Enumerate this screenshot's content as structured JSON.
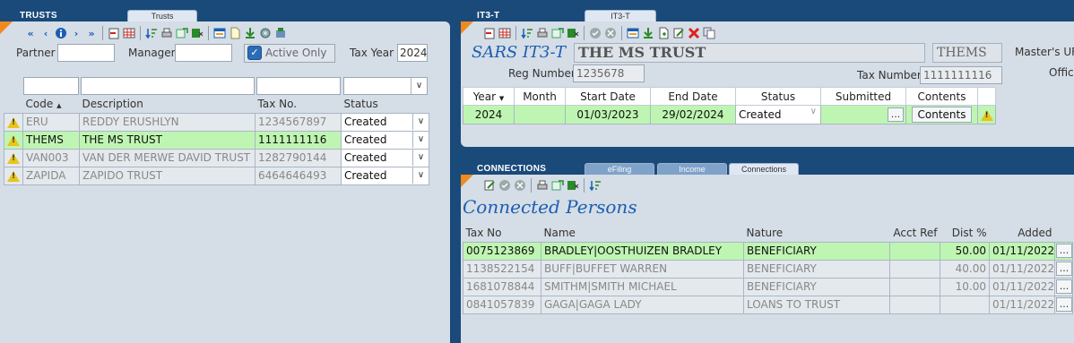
{
  "trusts": {
    "panel_title": "TRUSTS",
    "tab": "Trusts",
    "filters": {
      "partner_label": "Partner",
      "partner_value": "",
      "manager_label": "Manager",
      "manager_value": "",
      "active_only_label": "Active Only",
      "active_only_checked": true,
      "tax_year_label": "Tax Year",
      "tax_year_value": "2024"
    },
    "columns": [
      "Code",
      "Description",
      "Tax No.",
      "Status"
    ],
    "rows": [
      {
        "code": "ERU",
        "description": "REDDY ERUSHLYN",
        "tax_no": "1234567897",
        "status": "Created"
      },
      {
        "code": "THEMS",
        "description": "THE MS TRUST",
        "tax_no": "1111111116",
        "status": "Created"
      },
      {
        "code": "VAN003",
        "description": "VAN DER MERWE DAVID TRUST",
        "tax_no": "1282790144",
        "status": "Created"
      },
      {
        "code": "ZAPIDA",
        "description": "ZAPIDO TRUST",
        "tax_no": "6464646493",
        "status": "Created"
      }
    ],
    "selected_index": 1
  },
  "it3t": {
    "panel_title": "IT3-T",
    "tab": "IT3-T",
    "heading": "SARS IT3-T",
    "trust_name": "THE MS TRUST",
    "trust_code": "THEMS",
    "reg_label": "Reg Number",
    "reg_value": "1235678",
    "tax_label": "Tax Number",
    "tax_value": "1111111116",
    "master_label": "Master's URN",
    "office_label": "Office",
    "columns": [
      "Year",
      "Month",
      "Start Date",
      "End Date",
      "Status",
      "Submitted",
      "Contents"
    ],
    "row": {
      "year": "2024",
      "month": "",
      "start": "01/03/2023",
      "end": "29/02/2024",
      "status": "Created",
      "submitted": "",
      "contents_btn": "Contents"
    }
  },
  "connections": {
    "panel_title": "CONNECTIONS",
    "tabs": [
      "eFiling",
      "Income",
      "Connections"
    ],
    "heading": "Connected Persons",
    "columns": [
      "Tax No",
      "Name",
      "Nature",
      "Acct Ref",
      "Dist %",
      "Added"
    ],
    "rows": [
      {
        "tax_no": "0075123869",
        "name": "BRADLEY|OOSTHUIZEN BRADLEY",
        "nature": "BENEFICIARY",
        "acct_ref": "",
        "dist": "50.00",
        "added": "01/11/2022"
      },
      {
        "tax_no": "1138522154",
        "name": "BUFF|BUFFET WARREN",
        "nature": "BENEFICIARY",
        "acct_ref": "",
        "dist": "40.00",
        "added": "01/11/2022"
      },
      {
        "tax_no": "1681078844",
        "name": "SMITHM|SMITH MICHAEL",
        "nature": "BENEFICIARY",
        "acct_ref": "",
        "dist": "10.00",
        "added": "01/11/2022"
      },
      {
        "tax_no": "0841057839",
        "name": "GAGA|GAGA LADY",
        "nature": "LOANS TO TRUST",
        "acct_ref": "",
        "dist": "",
        "added": "01/11/2022"
      }
    ]
  },
  "icons": {
    "nav": [
      "first-icon",
      "prev-icon",
      "info-icon",
      "next-icon",
      "last-icon"
    ],
    "ellipsis": "...",
    "dropdown": "∨",
    "sort": "▲"
  }
}
